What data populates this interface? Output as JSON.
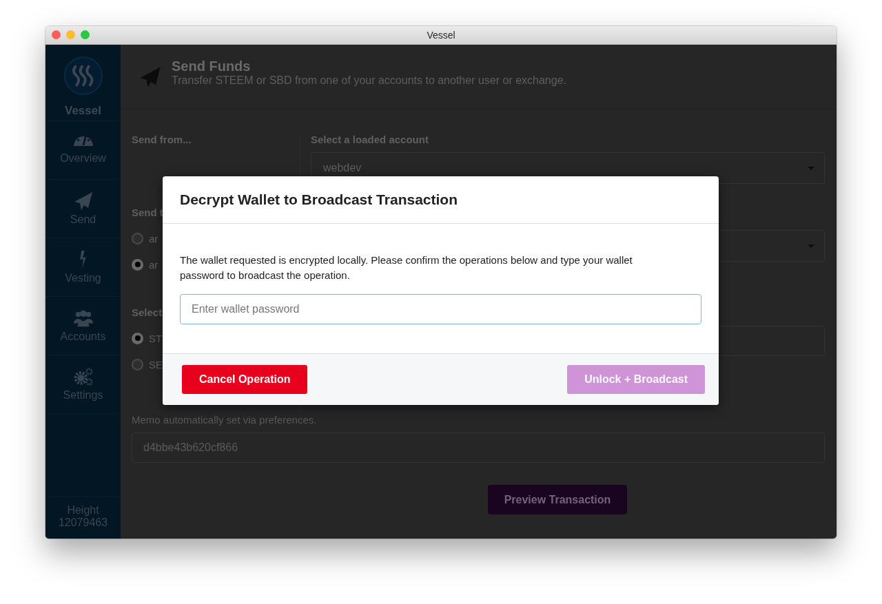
{
  "window": {
    "title": "Vessel"
  },
  "sidebar": {
    "brand": "Vessel",
    "items": [
      {
        "label": "Overview"
      },
      {
        "label": "Send"
      },
      {
        "label": "Vesting"
      },
      {
        "label": "Accounts"
      },
      {
        "label": "Settings"
      }
    ],
    "height_label": "Height",
    "height_value": "12079463"
  },
  "header": {
    "title": "Send Funds",
    "subtitle": "Transfer STEEM or SBD from one of your accounts to another user or exchange."
  },
  "form": {
    "send_from_label": "Send from...",
    "account_label": "Select a loaded account",
    "account_value": "webdev",
    "send_to_label": "Send t",
    "send_to_options": [
      {
        "label": "ar",
        "selected": false
      },
      {
        "label": "ar",
        "selected": true
      }
    ],
    "currency_label": "Select",
    "currency_options": [
      {
        "label": "ST",
        "selected": true
      },
      {
        "label": "SE",
        "selected": false
      }
    ],
    "memo_label": "Memo automatically set via preferences.",
    "memo_value": "d4bbe43b620cf866",
    "preview_button": "Preview Transaction"
  },
  "modal": {
    "title": "Decrypt Wallet to Broadcast Transaction",
    "message": "The wallet requested is encrypted locally. Please confirm the operations below and type your wallet password to broadcast the operation.",
    "password_placeholder": "Enter wallet password",
    "buttons": [
      {
        "label": "Cancel Operation",
        "kind": "danger",
        "disabled": false
      },
      {
        "label": "Unlock + Broadcast",
        "kind": "primary",
        "disabled": true
      }
    ]
  }
}
